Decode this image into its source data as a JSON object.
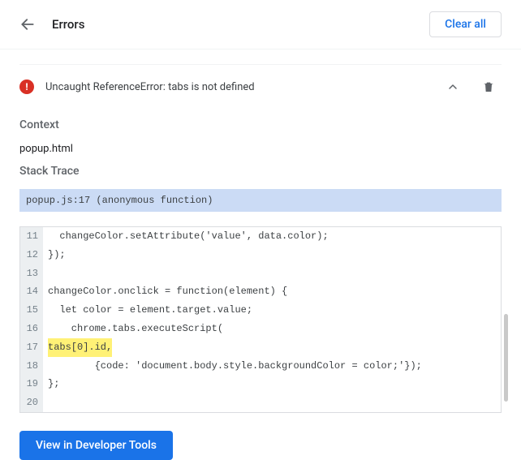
{
  "header": {
    "title": "Errors",
    "clear_button": "Clear all"
  },
  "error": {
    "message": "Uncaught ReferenceError: tabs is not defined"
  },
  "context": {
    "label": "Context",
    "value": "popup.html"
  },
  "stack_trace": {
    "label": "Stack Trace",
    "location": "popup.js:17 (anonymous function)"
  },
  "code": {
    "lines": [
      {
        "num": "11",
        "text": "  changeColor.setAttribute('value', data.color);",
        "highlight": false
      },
      {
        "num": "12",
        "text": "});",
        "highlight": false
      },
      {
        "num": "13",
        "text": "",
        "highlight": false
      },
      {
        "num": "14",
        "text": "changeColor.onclick = function(element) {",
        "highlight": false
      },
      {
        "num": "15",
        "text": "  let color = element.target.value;",
        "highlight": false
      },
      {
        "num": "16",
        "text": "    chrome.tabs.executeScript(",
        "highlight": false
      },
      {
        "num": "17",
        "text": "        tabs[0].id,",
        "highlight": true
      },
      {
        "num": "18",
        "text": "        {code: 'document.body.style.backgroundColor = color;'});",
        "highlight": false
      },
      {
        "num": "19",
        "text": "};",
        "highlight": false
      },
      {
        "num": "20",
        "text": "",
        "highlight": false
      }
    ]
  },
  "footer": {
    "view_tools_button": "View in Developer Tools"
  }
}
